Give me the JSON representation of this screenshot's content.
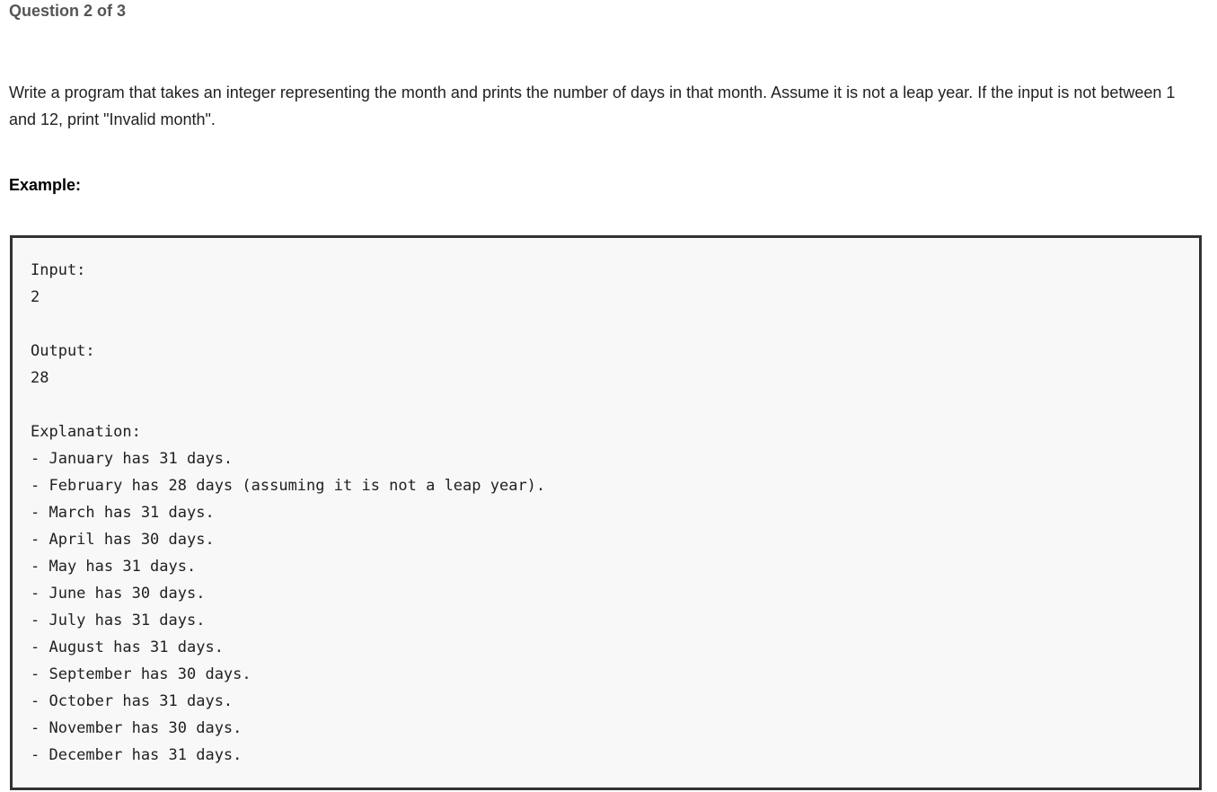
{
  "header": {
    "question_counter": "Question 2 of 3"
  },
  "question": {
    "prompt": "Write a program that takes an integer representing the month and prints the number of days in that month. Assume it is not a leap year. If the input is not between 1 and 12, print \"Invalid month\".",
    "example_label": "Example:"
  },
  "example": {
    "input_label": "Input:",
    "input_value": "2",
    "output_label": "Output:",
    "output_value": "28",
    "explanation_label": "Explanation:",
    "explanation_lines": [
      "- January has 31 days.",
      "- February has 28 days (assuming it is not a leap year).",
      "- March has 31 days.",
      "- April has 30 days.",
      "- May has 31 days.",
      "- June has 30 days.",
      "- July has 31 days.",
      "- August has 31 days.",
      "- September has 30 days.",
      "- October has 31 days.",
      "- November has 30 days.",
      "- December has 31 days."
    ]
  }
}
